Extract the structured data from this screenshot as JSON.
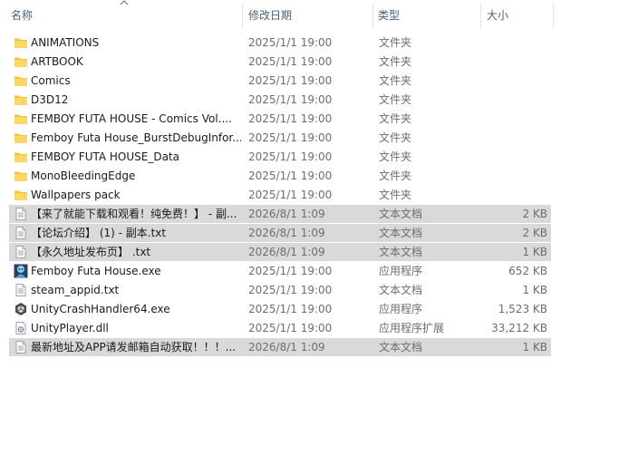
{
  "columns": {
    "name": "名称",
    "date": "修改日期",
    "type": "类型",
    "size": "大小"
  },
  "rows": [
    {
      "icon": "folder-icon",
      "name": "ANIMATIONS",
      "date": "2025/1/1 19:00",
      "type": "文件夹",
      "size": "",
      "selected": false
    },
    {
      "icon": "folder-icon",
      "name": "ARTBOOK",
      "date": "2025/1/1 19:00",
      "type": "文件夹",
      "size": "",
      "selected": false
    },
    {
      "icon": "folder-icon",
      "name": "Comics",
      "date": "2025/1/1 19:00",
      "type": "文件夹",
      "size": "",
      "selected": false
    },
    {
      "icon": "folder-icon",
      "name": "D3D12",
      "date": "2025/1/1 19:00",
      "type": "文件夹",
      "size": "",
      "selected": false
    },
    {
      "icon": "folder-icon",
      "name": "FEMBOY FUTA HOUSE - Comics Vol....",
      "date": "2025/1/1 19:00",
      "type": "文件夹",
      "size": "",
      "selected": false
    },
    {
      "icon": "folder-icon",
      "name": "Femboy Futa House_BurstDebugInfor...",
      "date": "2025/1/1 19:00",
      "type": "文件夹",
      "size": "",
      "selected": false
    },
    {
      "icon": "folder-icon",
      "name": "FEMBOY FUTA HOUSE_Data",
      "date": "2025/1/1 19:00",
      "type": "文件夹",
      "size": "",
      "selected": false
    },
    {
      "icon": "folder-icon",
      "name": "MonoBleedingEdge",
      "date": "2025/1/1 19:00",
      "type": "文件夹",
      "size": "",
      "selected": false
    },
    {
      "icon": "folder-icon",
      "name": "Wallpapers pack",
      "date": "2025/1/1 19:00",
      "type": "文件夹",
      "size": "",
      "selected": false
    },
    {
      "icon": "text-file-icon",
      "name": "【来了就能下载和观看！纯免费！】 - 副...",
      "date": "2026/8/1 1:09",
      "type": "文本文档",
      "size": "2 KB",
      "selected": true
    },
    {
      "icon": "text-file-icon",
      "name": "【论坛介绍】 (1) - 副本.txt",
      "date": "2026/8/1 1:09",
      "type": "文本文档",
      "size": "2 KB",
      "selected": true
    },
    {
      "icon": "text-file-icon",
      "name": "【永久地址发布页】 .txt",
      "date": "2026/8/1 1:09",
      "type": "文本文档",
      "size": "1 KB",
      "selected": true
    },
    {
      "icon": "game-exe-icon",
      "name": "Femboy Futa House.exe",
      "date": "2025/1/1 19:00",
      "type": "应用程序",
      "size": "652 KB",
      "selected": false
    },
    {
      "icon": "text-file-icon",
      "name": "steam_appid.txt",
      "date": "2025/1/1 19:00",
      "type": "文本文档",
      "size": "1 KB",
      "selected": false
    },
    {
      "icon": "unity-exe-icon",
      "name": "UnityCrashHandler64.exe",
      "date": "2025/1/1 19:00",
      "type": "应用程序",
      "size": "1,523 KB",
      "selected": false
    },
    {
      "icon": "dll-file-icon",
      "name": "UnityPlayer.dll",
      "date": "2025/1/1 19:00",
      "type": "应用程序扩展",
      "size": "33,212 KB",
      "selected": false
    },
    {
      "icon": "text-file-icon",
      "name": "最新地址及APP请发邮箱自动获取！！！...",
      "date": "2026/8/1 1:09",
      "type": "文本文档",
      "size": "1 KB",
      "selected": true
    }
  ]
}
